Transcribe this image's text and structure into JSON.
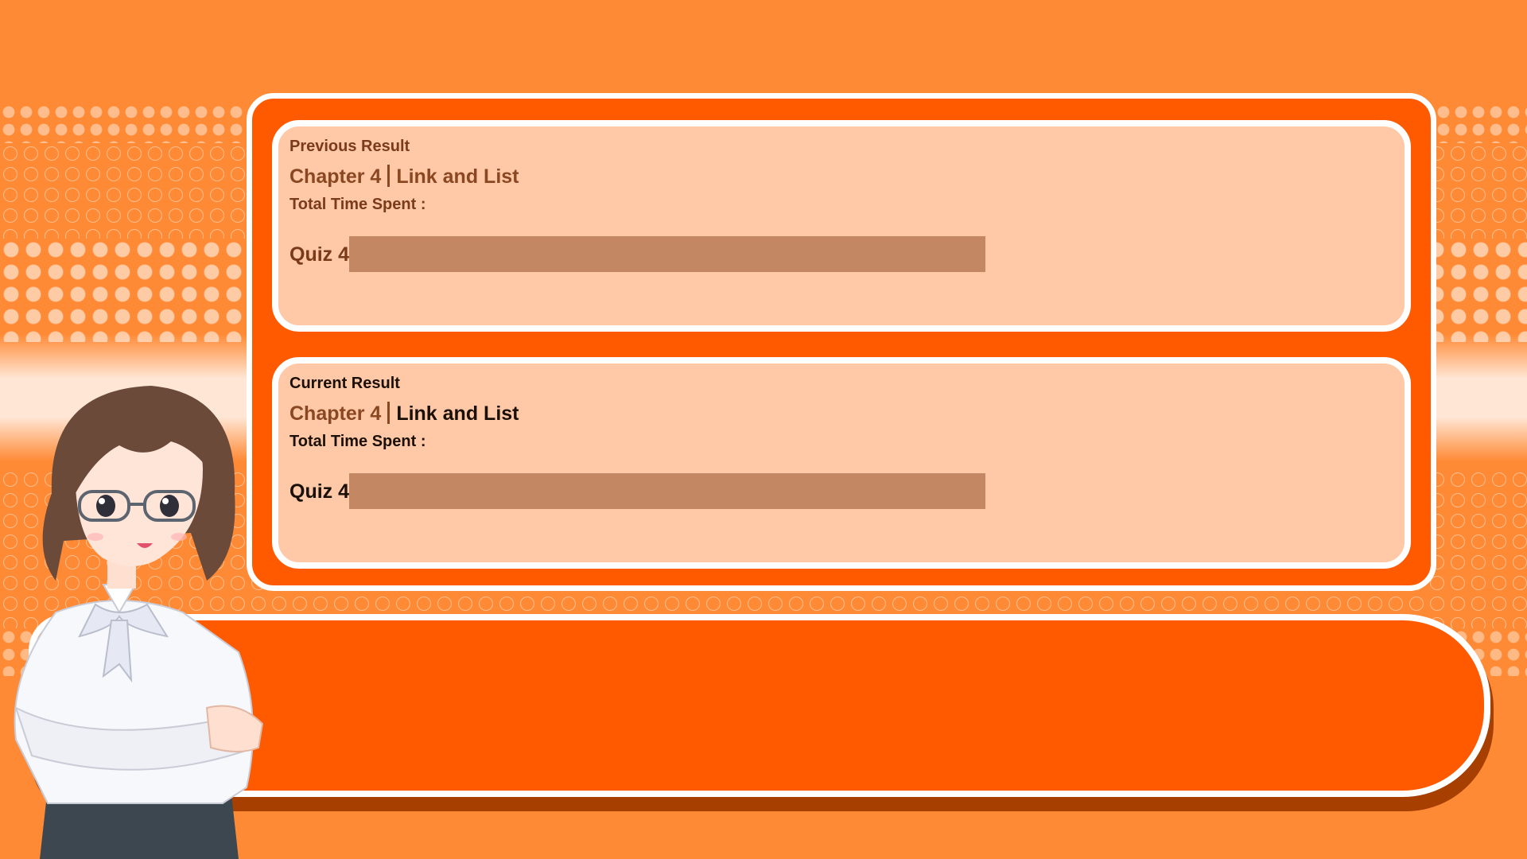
{
  "colors": {
    "background": "#ff8a35",
    "panel": "#ff5a00",
    "card": "#ffc8a6",
    "bar": "#c48763",
    "dialog": "#ff5a00",
    "previous_text": "#7a3b1a",
    "current_text": "#1a1008"
  },
  "previous": {
    "heading": "Previous Result",
    "chapter_number": "Chapter 4",
    "chapter_title": "Link and List",
    "time_label": "Total Time Spent :",
    "quiz_label": "Quiz 4"
  },
  "current": {
    "heading": "Current Result",
    "chapter_number": "Chapter 4",
    "chapter_title": "Link and List",
    "time_label": "Total Time Spent :",
    "quiz_label": "Quiz 4"
  },
  "dialog": {
    "text": ""
  },
  "character": {
    "icon": "anime-teacher-character"
  }
}
